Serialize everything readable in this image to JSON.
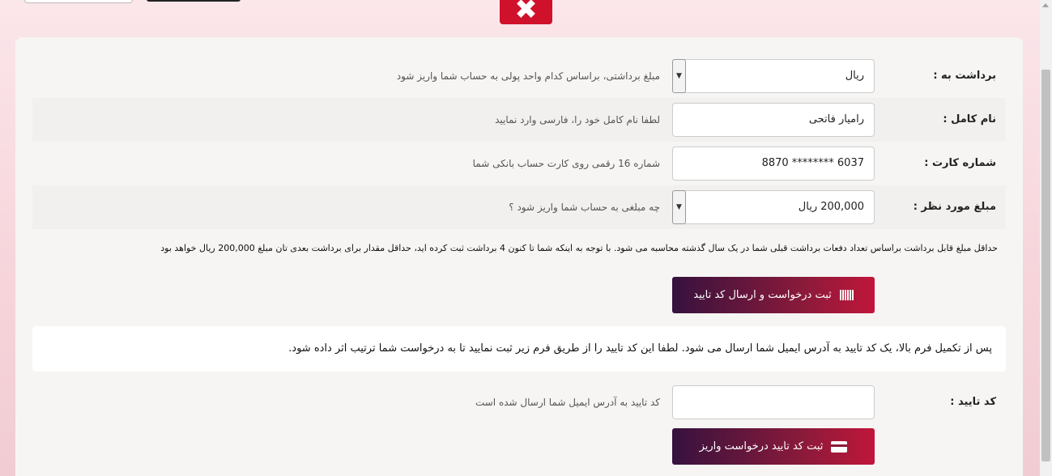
{
  "header": {
    "close_icon": "close-icon",
    "close_glyph": "✖"
  },
  "form": {
    "withdraw_to": {
      "label": "برداشت به :",
      "value": "ریال",
      "hint": "مبلغ برداشتی، براساس کدام واحد پولی به حساب شما واریز شود"
    },
    "full_name": {
      "label": "نام کامل :",
      "value": "رامیار فاتحی",
      "hint": "لطفا نام کامل خود را، فارسی وارد نمایید"
    },
    "card_number": {
      "label": "شماره کارت :",
      "value": "8870 ******** 6037",
      "hint": "شماره 16 رقمی روی کارت حساب بانکی شما"
    },
    "amount": {
      "label": "مبلغ مورد نظر :",
      "value": "200,000 ریال",
      "hint": "چه مبلغی به حساب شما واریز شود ؟"
    },
    "note": "حداقل مبلغ قابل برداشت براساس تعداد دفعات برداشت قبلی شما در یک سال گذشته محاسبه می شود. با توجه به اینکه شما تا کنون 4 برداشت ثبت کرده اید، حداقل مقدار برای برداشت بعدی تان مبلغ 200,000 ریال خواهد بود",
    "submit_label": "ثبت درخواست و ارسال کد تایید",
    "info": "پس از تکمیل فرم بالا، یک کد تایید به آدرس ایمیل شما ارسال می شود. لطفا این کد تایید را از طریق فرم زیر ثبت نمایید تا به درخواست شما ترتیب اثر داده شود.",
    "code": {
      "label": "کد تایید :",
      "value": "",
      "hint": "کد تایید به آدرس ایمیل شما ارسال شده است"
    },
    "confirm_label": "ثبت کد تایید درخواست واریز"
  },
  "colors": {
    "accent": "#d0112b",
    "button_start": "#36123e",
    "button_end": "#c0163a"
  }
}
